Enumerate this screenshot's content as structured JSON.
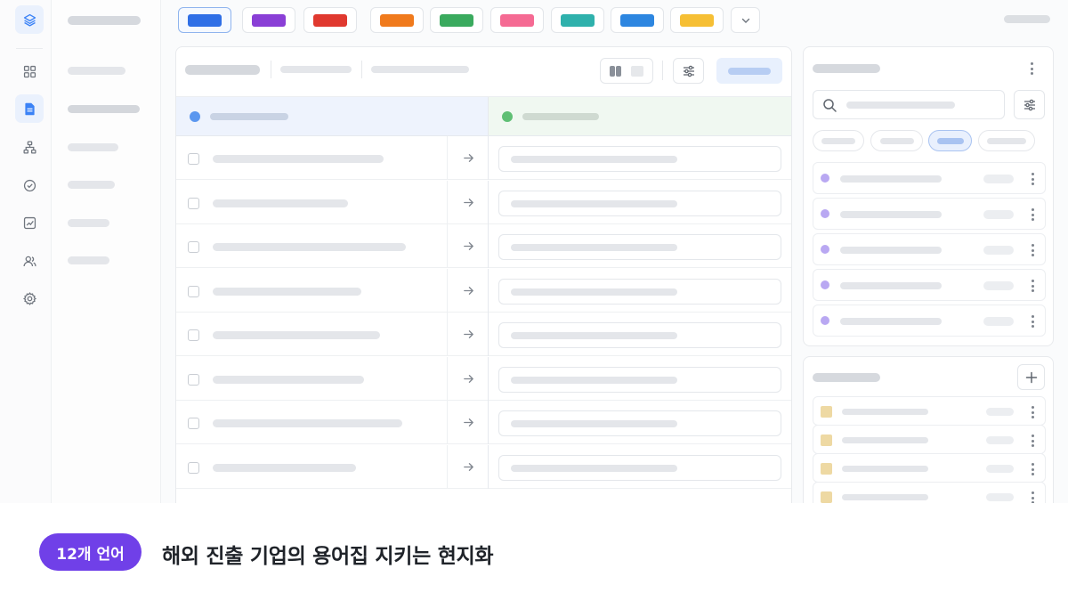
{
  "caption": {
    "badge": "12개 언어",
    "headline": "해외 진출 기업의 용어집 지키는 현지화"
  },
  "colors": {
    "accent": "#3b82f6",
    "badge": "#7040e8",
    "swatches": [
      "#2f6fe6",
      "#8a3fd6",
      "#e0392f",
      "#f07a1c",
      "#3aaa5e",
      "#f56a93",
      "#2fb1ac",
      "#2d86e0",
      "#f6bf34"
    ],
    "column_a_dot": "#5b97ef",
    "column_b_dot": "#5fbf74",
    "list_dot": "#b9a8f2",
    "glossary_square": "#eed9a3"
  },
  "rail": {
    "icons": [
      "layers-icon",
      "grid-icon",
      "document-icon",
      "sitemap-icon",
      "check-circle-icon",
      "chart-icon",
      "users-icon",
      "gear-icon"
    ],
    "active": "document-icon"
  },
  "toolbar": {
    "swatch_count": 9,
    "selected_swatch": 1,
    "more_icon": "chevron-down-icon"
  },
  "table": {
    "row_count": 8,
    "row_icon": "arrow-right-icon"
  },
  "side_lists": {
    "terms_count": 5,
    "glossary_count": 4,
    "search_icon": "search-icon",
    "filter_icon": "sliders-icon",
    "add_icon": "plus-icon"
  }
}
